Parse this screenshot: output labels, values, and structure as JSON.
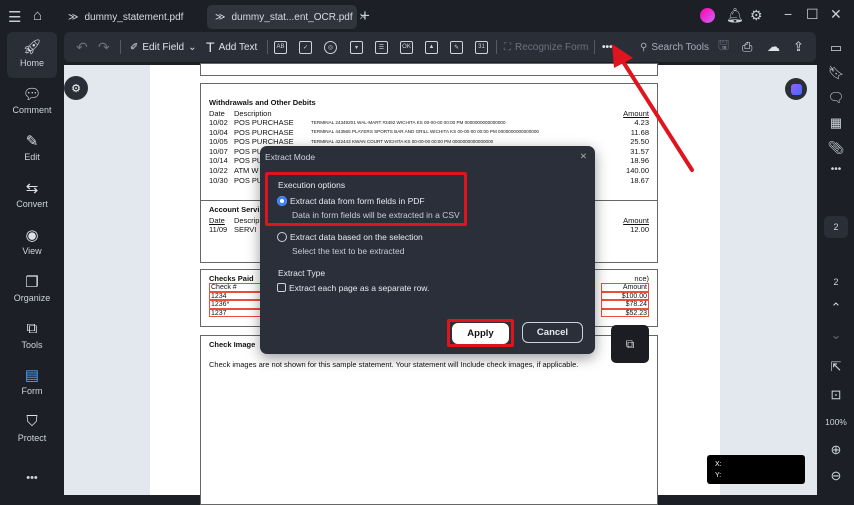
{
  "tabs": [
    {
      "label": "dummy_statement.pdf"
    },
    {
      "label": "dummy_stat...ent_OCR.pdf"
    }
  ],
  "toolbar": {
    "edit_field": "Edit Field",
    "add_text": "Add Text",
    "recognize_form": "Recognize Form",
    "more": "•••",
    "search_tools": "Search Tools",
    "field_icons": [
      "AB",
      "✓",
      "◎",
      "▾",
      "☰",
      "OK",
      "▲",
      "✎",
      "31"
    ]
  },
  "left_nav": [
    {
      "label": "Home",
      "icon": "rocket-icon"
    },
    {
      "label": "Comment",
      "icon": "comment-icon"
    },
    {
      "label": "Edit",
      "icon": "edit-icon"
    },
    {
      "label": "Convert",
      "icon": "convert-icon"
    },
    {
      "label": "View",
      "icon": "view-icon"
    },
    {
      "label": "Organize",
      "icon": "organize-icon"
    },
    {
      "label": "Tools",
      "icon": "tools-icon"
    },
    {
      "label": "Form",
      "icon": "form-icon"
    },
    {
      "label": "Protect",
      "icon": "protect-icon"
    }
  ],
  "more_label": "•••",
  "document": {
    "withdrawals": {
      "title": "Withdrawals and Other Debits",
      "headers": [
        "Date",
        "Description",
        "Amount"
      ],
      "rows": [
        [
          "10/02",
          "POS PURCHASE",
          "TERMINAL 24349201 WAL-MART #3492 WICHITA KS 00-00-00 00:00 PM 0000000000000000",
          "4.23"
        ],
        [
          "10/04",
          "POS PURCHASE",
          "TERMINAL 443565 PLAYERS SPORTS BAR AND GRILL WICHITA KS 00-00-00 00:00 PM 0000000000000000",
          "11.68"
        ],
        [
          "10/05",
          "POS PURCHASE",
          "TERMINAL 422443 KWAN COURT WICHITA KS 00-00-00 00:00 PM 0000000000000000",
          "25.50"
        ],
        [
          "10/07",
          "POS PU",
          "",
          "31.57"
        ],
        [
          "10/14",
          "POS PU",
          "",
          "18.96"
        ],
        [
          "10/22",
          "ATM W",
          "",
          "140.00"
        ],
        [
          "10/30",
          "POS PU",
          "",
          "18.67"
        ]
      ]
    },
    "service": {
      "title": "Account Servi",
      "headers": [
        "Date",
        "Descrip",
        "Amount"
      ],
      "rows": [
        [
          "11/09",
          "SERVI",
          "12.00"
        ]
      ]
    },
    "checks": {
      "title": "Checks Paid",
      "suffix": "nce)",
      "headers": [
        "Check #",
        "Amount"
      ],
      "rows": [
        [
          "1234",
          "$100.00"
        ],
        [
          "1236*",
          "$78.24"
        ],
        [
          "1237",
          "$52.23"
        ]
      ]
    },
    "images": {
      "title": "Check Image",
      "text": "Check images are not shown for this sample statement.  Your statement will Include check images, if applicable."
    }
  },
  "dialog": {
    "title": "Extract Mode",
    "section1": "Execution options",
    "option1": {
      "label": "Extract data from form fields in PDF",
      "desc": "Data in form fields will be extracted in a CSV",
      "selected": true
    },
    "option2": {
      "label": "Extract data based on the selection",
      "desc": "Select the text to be extracted",
      "selected": false
    },
    "section2": "Extract Type",
    "checkbox": {
      "label": "Extract each page as a separate row.",
      "checked": false
    },
    "apply": "Apply",
    "cancel": "Cancel"
  },
  "right": {
    "page_current": "2",
    "page_total": "2",
    "zoom": "100%",
    "more": "•••"
  },
  "coords": {
    "x": "X:",
    "y": "Y:"
  },
  "colors": {
    "accent": "#3b82f6",
    "highlight": "#e0141e"
  }
}
